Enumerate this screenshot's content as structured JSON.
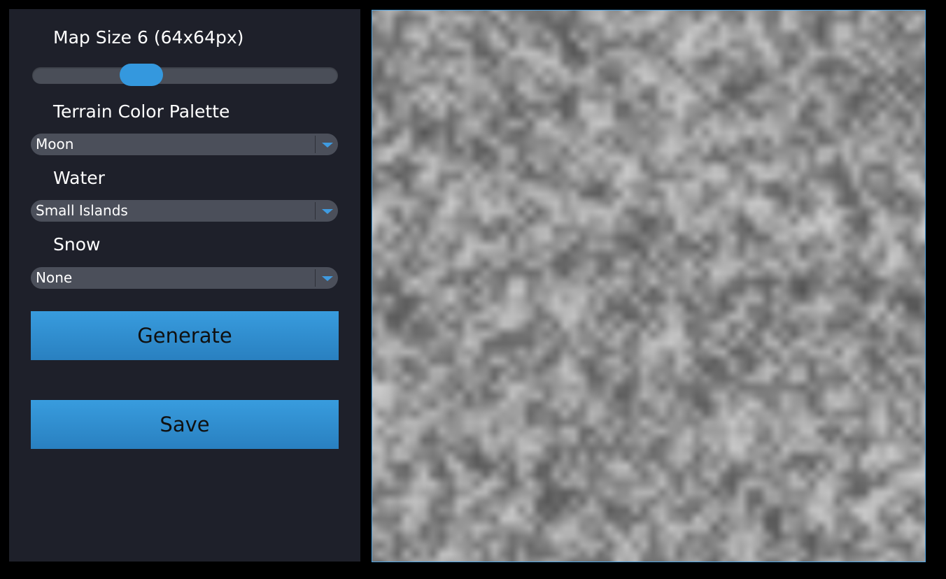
{
  "sidebar": {
    "map_size_label": "Map Size 6 (64x64px)",
    "map_size_slider": {
      "value": 6,
      "min": 1,
      "max": 16
    },
    "palette_label": "Terrain Color Palette",
    "palette_value": "Moon",
    "water_label": "Water",
    "water_value": "Small Islands",
    "snow_label": "Snow",
    "snow_value": "None",
    "generate_label": "Generate",
    "save_label": "Save"
  },
  "map": {
    "grid_size": 64,
    "palette": "grayscale"
  },
  "colors": {
    "panel_bg": "#1e202a",
    "accent": "#3498de",
    "control_bg": "#4b4f5a",
    "map_border": "#4ea3e2"
  }
}
